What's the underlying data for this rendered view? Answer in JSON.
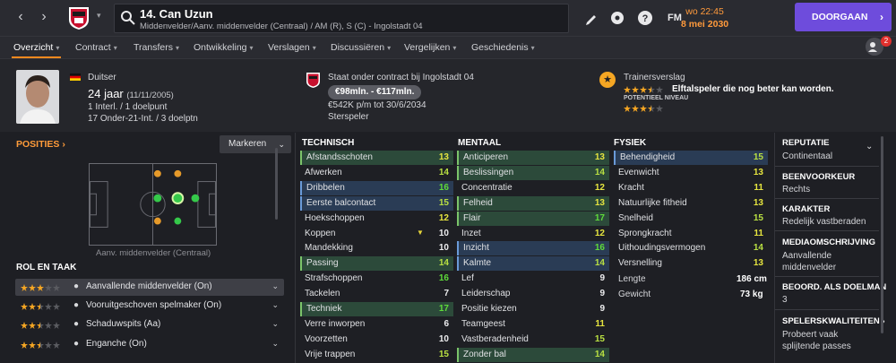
{
  "header": {
    "player_title": "14. Can Uzun",
    "player_subtitle": "Middenvelder/Aanv. middenvelder (Centraal) / AM (R), S (C) - Ingolstadt 04",
    "fm_label": "FM",
    "time": "wo 22:45",
    "date": "8 mei 2030",
    "continue_label": "DOORGAAN"
  },
  "tabs": [
    {
      "label": "Overzicht"
    },
    {
      "label": "Contract"
    },
    {
      "label": "Transfers"
    },
    {
      "label": "Ontwikkeling"
    },
    {
      "label": "Verslagen"
    },
    {
      "label": "Discussiëren"
    },
    {
      "label": "Vergelijken"
    },
    {
      "label": "Geschiedenis"
    }
  ],
  "notifications": "2",
  "profile": {
    "nationality": "Duitser",
    "age": "24 jaar",
    "dob": "(11/11/2005)",
    "caps": "1 Interl. / 1 doelpunt",
    "youth_caps": "17 Onder-21-Int. / 3 doelptn",
    "contract_text": "Staat onder contract bij Ingolstadt 04",
    "value": "€98mln. - €117mln.",
    "wage": "€542K p/m tot 30/6/2034",
    "status": "Sterspeler",
    "report_title": "Trainersverslag",
    "report_text": "Elftalspeler die nog beter kan worden.",
    "potential_label": "POTENTIEEL NIVEAU",
    "current_stars": 3.5,
    "potential_stars": 3.5
  },
  "positions": {
    "title": "POSITIES",
    "highlight_label": "Markeren",
    "caption": "Aanv. middenvelder (Centraal)"
  },
  "roles": {
    "title": "ROL EN TAAK",
    "items": [
      {
        "label": "Aanvallende middenvelder (On)",
        "stars": 3
      },
      {
        "label": "Vooruitgeschoven spelmaker (On)",
        "stars": 2.5
      },
      {
        "label": "Schaduwspits (Aa)",
        "stars": 2.5
      },
      {
        "label": "Enganche (On)",
        "stars": 2.5
      }
    ]
  },
  "technical": {
    "title": "TECHNISCH",
    "items": [
      {
        "name": "Afstandsschoten",
        "value": "13"
      },
      {
        "name": "Afwerken",
        "value": "14"
      },
      {
        "name": "Dribbelen",
        "value": "16"
      },
      {
        "name": "Eerste balcontact",
        "value": "15"
      },
      {
        "name": "Hoekschoppen",
        "value": "12"
      },
      {
        "name": "Koppen",
        "value": "10"
      },
      {
        "name": "Mandekking",
        "value": "10"
      },
      {
        "name": "Passing",
        "value": "14"
      },
      {
        "name": "Strafschoppen",
        "value": "16"
      },
      {
        "name": "Tackelen",
        "value": "7"
      },
      {
        "name": "Techniek",
        "value": "17"
      },
      {
        "name": "Verre inworpen",
        "value": "6"
      },
      {
        "name": "Voorzetten",
        "value": "10"
      },
      {
        "name": "Vrije trappen",
        "value": "15"
      }
    ]
  },
  "mental": {
    "title": "MENTAAL",
    "items": [
      {
        "name": "Anticiperen",
        "value": "13"
      },
      {
        "name": "Beslissingen",
        "value": "14"
      },
      {
        "name": "Concentratie",
        "value": "12"
      },
      {
        "name": "Felheid",
        "value": "13"
      },
      {
        "name": "Flair",
        "value": "17"
      },
      {
        "name": "Inzet",
        "value": "12"
      },
      {
        "name": "Inzicht",
        "value": "16"
      },
      {
        "name": "Kalmte",
        "value": "14"
      },
      {
        "name": "Lef",
        "value": "9"
      },
      {
        "name": "Leiderschap",
        "value": "9"
      },
      {
        "name": "Positie kiezen",
        "value": "9"
      },
      {
        "name": "Teamgeest",
        "value": "11"
      },
      {
        "name": "Vastberadenheid",
        "value": "15"
      },
      {
        "name": "Zonder bal",
        "value": "14"
      }
    ]
  },
  "physical": {
    "title": "FYSIEK",
    "items": [
      {
        "name": "Behendigheid",
        "value": "15"
      },
      {
        "name": "Evenwicht",
        "value": "13"
      },
      {
        "name": "Kracht",
        "value": "11"
      },
      {
        "name": "Natuurlijke fitheid",
        "value": "13"
      },
      {
        "name": "Snelheid",
        "value": "15"
      },
      {
        "name": "Sprongkracht",
        "value": "11"
      },
      {
        "name": "Uithoudingsvermogen",
        "value": "14"
      },
      {
        "name": "Versnelling",
        "value": "13"
      }
    ],
    "height_label": "Lengte",
    "height": "186 cm",
    "weight_label": "Gewicht",
    "weight": "73 kg"
  },
  "info": {
    "reputation_title": "REPUTATIE",
    "reputation": "Continentaal",
    "foot_title": "BEENVOORKEUR",
    "foot": "Rechts",
    "character_title": "KARAKTER",
    "character": "Redelijk vastberaden",
    "media_title": "MEDIAOMSCHRIJVING",
    "media": "Aanvallende middenvelder",
    "gk_title": "BEOORD. ALS DOELMAN",
    "gk": "3",
    "qualities_title": "SPELERSKWALITEITEN",
    "qualities": "Probeert vaak splijtende passes"
  },
  "colors": {
    "accent": "#ff8a1f",
    "continue": "#6e4cdc",
    "star": "#f5a623"
  }
}
